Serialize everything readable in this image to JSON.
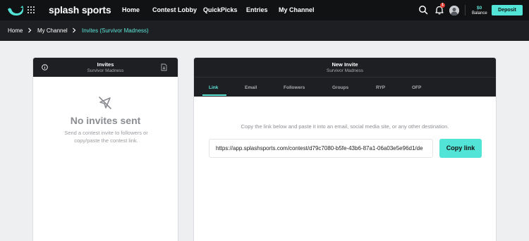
{
  "nav": {
    "brand": "splash sports",
    "items": [
      "Home",
      "Contest Lobby",
      "QuickPicks",
      "Entries",
      "My Channel"
    ],
    "notification_count": "1",
    "balance_amount": "$0",
    "balance_label": "Balance",
    "deposit_label": "Deposit"
  },
  "breadcrumb": [
    "Home",
    "My Channel",
    "Invites (Survivor Madness)"
  ],
  "invites_panel": {
    "title": "Invites",
    "subtitle": "Survivor Madness",
    "empty_title": "No invites sent",
    "empty_text": "Send a contest invite to followers or copy/paste the contest link."
  },
  "new_invite_panel": {
    "title": "New Invite",
    "subtitle": "Survivor Madness",
    "tabs": [
      "Link",
      "Email",
      "Followers",
      "Groups",
      "RYP",
      "OFP"
    ],
    "active_tab": "Link",
    "instructions": "Copy the link below and paste it into an email, social media site, or any other destination.",
    "link_value": "https://app.splashsports.com/contest/d79c7080-b5fe-43b6-87a1-06a03e5e96d1/de",
    "copy_label": "Copy link"
  },
  "colors": {
    "accent": "#52e4d6",
    "nav_bg": "#111214",
    "panel_header_bg": "#1e1f22",
    "page_bg": "#eeeff1"
  },
  "icons": [
    "whale-logo-icon",
    "apps-grid-icon",
    "search-icon",
    "bell-icon",
    "chevron-right-icon",
    "info-icon",
    "export-icon",
    "paper-plane-off-icon"
  ]
}
